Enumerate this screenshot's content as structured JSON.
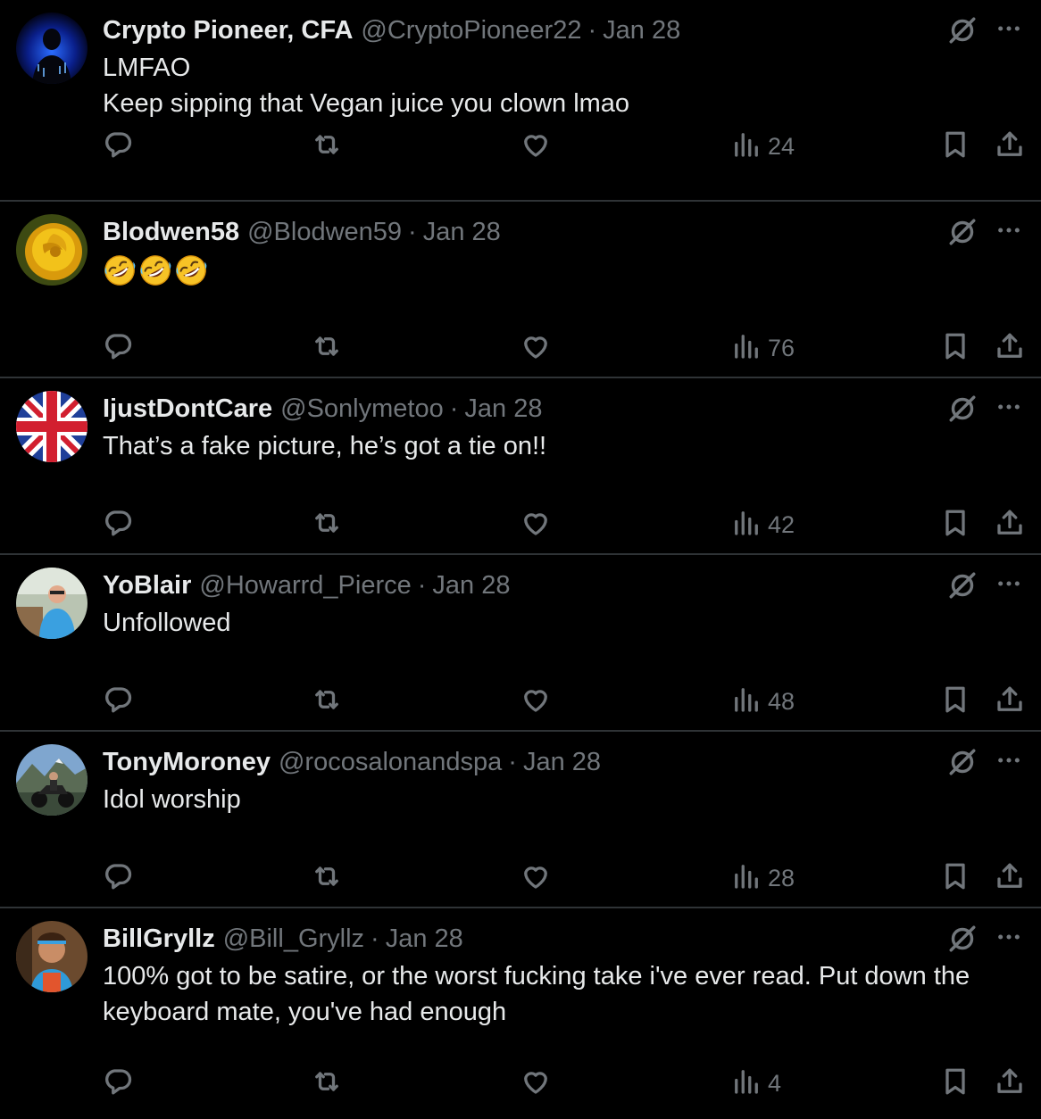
{
  "colors": {
    "background": "#000000",
    "primary_text": "#e7e9ea",
    "secondary_text": "#71767b",
    "divider": "#2f3336"
  },
  "icons": [
    "reply-icon",
    "retweet-icon",
    "like-icon",
    "views-icon",
    "bookmark-icon",
    "share-icon",
    "grok-icon",
    "more-icon"
  ],
  "separator": "·",
  "tweets": [
    {
      "name": "Crypto Pioneer, CFA",
      "handle": "@CryptoPioneer22",
      "date": "Jan 28",
      "text_lines": [
        "LMFAO",
        "Keep sipping that Vegan juice you clown lmao"
      ],
      "views": "24",
      "avatar": "hooded-figure-blue"
    },
    {
      "name": "Blodwen58",
      "handle": "@Blodwen59",
      "date": "Jan 28",
      "text_lines": [],
      "emojis": [
        "rolling-on-floor-laughing",
        "rolling-on-floor-laughing",
        "rolling-on-floor-laughing"
      ],
      "views": "76",
      "avatar": "yellow-rose"
    },
    {
      "name": "IjustDontCare",
      "handle": "@Sonlymetoo",
      "date": "Jan 28",
      "text_lines": [
        "That’s a fake picture, he’s got a tie on!!"
      ],
      "views": "42",
      "avatar": "union-jack"
    },
    {
      "name": "YoBlair",
      "handle": "@Howarrd_Pierce",
      "date": "Jan 28",
      "text_lines": [
        "Unfollowed"
      ],
      "views": "48",
      "avatar": "man-in-blue-shirt"
    },
    {
      "name": "TonyMoroney",
      "handle": "@rocosalonandspa",
      "date": "Jan 28",
      "text_lines": [
        "Idol worship"
      ],
      "views": "28",
      "avatar": "motorcycle-mountains"
    },
    {
      "name": "BillGryllz",
      "handle": "@Bill_Gryllz",
      "date": "Jan 28",
      "text_lines": [
        "100% got to be satire, or the worst fucking take i've ever read. Put down the",
        "keyboard mate, you've had enough"
      ],
      "views": "4",
      "avatar": "man-with-headband"
    }
  ]
}
